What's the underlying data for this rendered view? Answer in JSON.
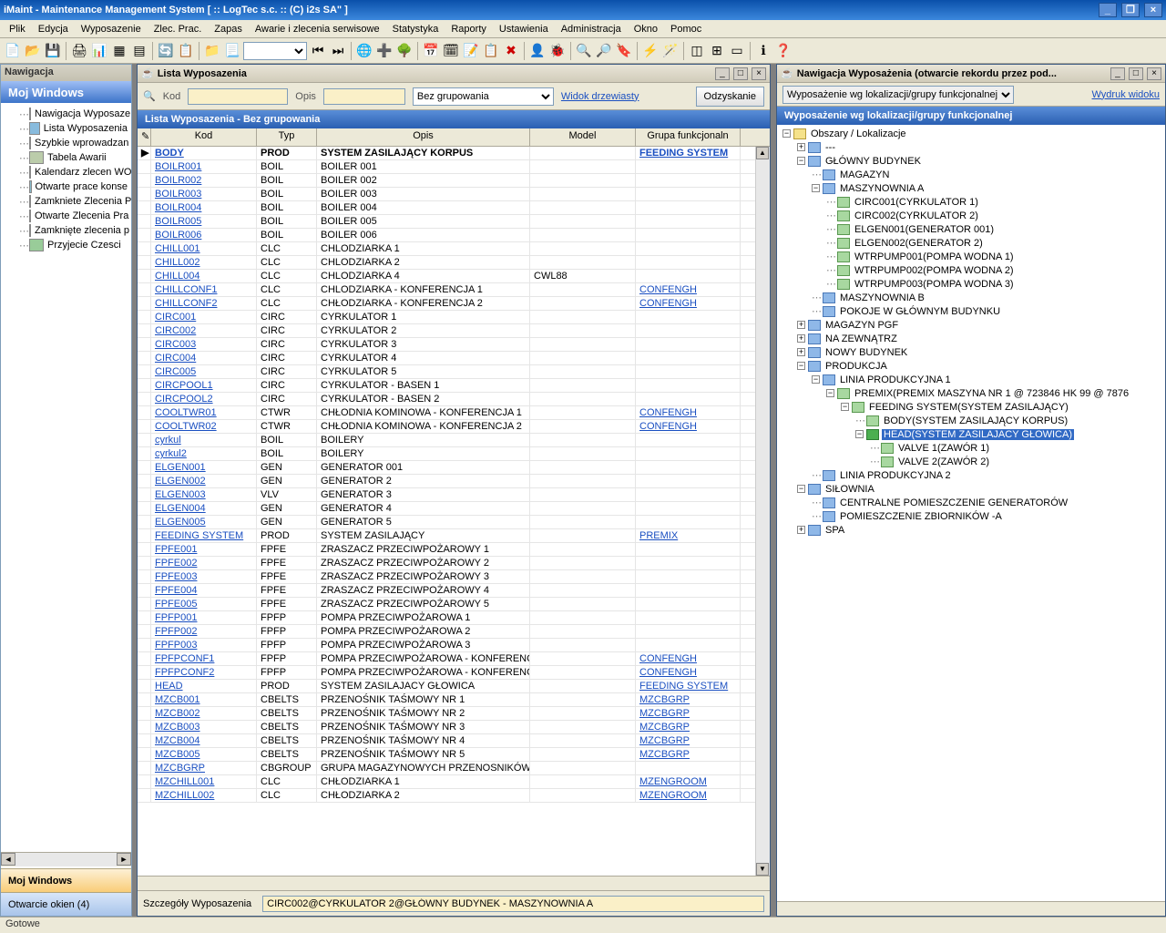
{
  "app": {
    "title": "iMaint - Maintenance Management System [ :: LogTec s.c. :: (C) i2s SA\" ]",
    "status": "Gotowe"
  },
  "menu": [
    "Plik",
    "Edycja",
    "Wyposazenie",
    "Zlec. Prac.",
    "Zapas",
    "Awarie i zlecenia serwisowe",
    "Statystyka",
    "Raporty",
    "Ustawienia",
    "Administracja",
    "Okno",
    "Pomoc"
  ],
  "nav": {
    "panel_title": "Nawigacja",
    "group": "Moj Windows",
    "items": [
      "Nawigacja Wyposaze",
      "Lista Wyposazenia",
      "Szybkie wprowadzan",
      "Tabela Awarii",
      "Kalendarz zlecen WO",
      "Otwarte prace konse",
      "Zamkniete Zlecenia P",
      "Otwarte Zlecenia Pra",
      "Zamknięte zlecenia p",
      "Przyjecie Czesci"
    ],
    "btn1": "Moj Windows",
    "btn2": "Otwarcie okien (4)"
  },
  "list": {
    "win_title": "Lista Wyposazenia",
    "kod_label": "Kod",
    "opis_label": "Opis",
    "group_select": "Bez grupowania",
    "tree_link": "Widok drzewiasty",
    "refresh_btn": "Odzyskanie",
    "grid_title": "Lista Wyposazenia - Bez grupowania",
    "cols": {
      "kod": "Kod",
      "typ": "Typ",
      "opis": "Opis",
      "model": "Model",
      "grupa": "Grupa funkcjonaln"
    },
    "detail_label": "Szczegóły Wyposazenia",
    "detail_value": "CIRC002@CYRKULATOR 2@GŁÓWNY BUDYNEK - MASZYNOWNIA A",
    "rows": [
      {
        "kod": "BODY",
        "typ": "PROD",
        "opis": "SYSTEM ZASILAJĄCY KORPUS",
        "model": "",
        "grupa": "FEEDING SYSTEM",
        "sel": true
      },
      {
        "kod": "BOILR001",
        "typ": "BOIL",
        "opis": "BOILER 001",
        "model": "",
        "grupa": ""
      },
      {
        "kod": "BOILR002",
        "typ": "BOIL",
        "opis": "BOILER 002",
        "model": "",
        "grupa": ""
      },
      {
        "kod": "BOILR003",
        "typ": "BOIL",
        "opis": "BOILER 003",
        "model": "",
        "grupa": ""
      },
      {
        "kod": "BOILR004",
        "typ": "BOIL",
        "opis": "BOILER 004",
        "model": "",
        "grupa": ""
      },
      {
        "kod": "BOILR005",
        "typ": "BOIL",
        "opis": "BOILER 005",
        "model": "",
        "grupa": ""
      },
      {
        "kod": "BOILR006",
        "typ": "BOIL",
        "opis": "BOILER 006",
        "model": "",
        "grupa": ""
      },
      {
        "kod": "CHILL001",
        "typ": "CLC",
        "opis": "CHLODZIARKA 1",
        "model": "",
        "grupa": ""
      },
      {
        "kod": "CHILL002",
        "typ": "CLC",
        "opis": "CHLODZIARKA 2",
        "model": "",
        "grupa": ""
      },
      {
        "kod": "CHILL004",
        "typ": "CLC",
        "opis": "CHLODZIARKA 4",
        "model": "CWL88",
        "grupa": ""
      },
      {
        "kod": "CHILLCONF1",
        "typ": "CLC",
        "opis": "CHLODZIARKA - KONFERENCJA 1",
        "model": "",
        "grupa": "CONFENGH"
      },
      {
        "kod": "CHILLCONF2",
        "typ": "CLC",
        "opis": "CHŁODZIARKA - KONFERENCJA 2",
        "model": "",
        "grupa": "CONFENGH"
      },
      {
        "kod": "CIRC001",
        "typ": "CIRC",
        "opis": "CYRKULATOR 1",
        "model": "",
        "grupa": ""
      },
      {
        "kod": "CIRC002",
        "typ": "CIRC",
        "opis": "CYRKULATOR 2",
        "model": "",
        "grupa": ""
      },
      {
        "kod": "CIRC003",
        "typ": "CIRC",
        "opis": "CYRKULATOR 3",
        "model": "",
        "grupa": ""
      },
      {
        "kod": "CIRC004",
        "typ": "CIRC",
        "opis": "CYRKULATOR 4",
        "model": "",
        "grupa": ""
      },
      {
        "kod": "CIRC005",
        "typ": "CIRC",
        "opis": "CYRKULATOR 5",
        "model": "",
        "grupa": ""
      },
      {
        "kod": "CIRCPOOL1",
        "typ": "CIRC",
        "opis": "CYRKULATOR - BASEN 1",
        "model": "",
        "grupa": ""
      },
      {
        "kod": "CIRCPOOL2",
        "typ": "CIRC",
        "opis": "CYRKULATOR - BASEN 2",
        "model": "",
        "grupa": ""
      },
      {
        "kod": "COOLTWR01",
        "typ": "CTWR",
        "opis": "CHŁODNIA KOMINOWA - KONFERENCJA 1",
        "model": "",
        "grupa": "CONFENGH"
      },
      {
        "kod": "COOLTWR02",
        "typ": "CTWR",
        "opis": "CHŁODNIA KOMINOWA - KONFERENCJA 2",
        "model": "",
        "grupa": "CONFENGH"
      },
      {
        "kod": "cyrkul",
        "typ": "BOIL",
        "opis": "BOILERY",
        "model": "",
        "grupa": ""
      },
      {
        "kod": "cyrkul2",
        "typ": "BOIL",
        "opis": "BOILERY",
        "model": "",
        "grupa": ""
      },
      {
        "kod": "ELGEN001",
        "typ": "GEN",
        "opis": "GENERATOR 001",
        "model": "",
        "grupa": ""
      },
      {
        "kod": "ELGEN002",
        "typ": "GEN",
        "opis": "GENERATOR 2",
        "model": "",
        "grupa": ""
      },
      {
        "kod": "ELGEN003",
        "typ": "VLV",
        "opis": "GENERATOR 3",
        "model": "",
        "grupa": ""
      },
      {
        "kod": "ELGEN004",
        "typ": "GEN",
        "opis": "GENERATOR 4",
        "model": "",
        "grupa": ""
      },
      {
        "kod": "ELGEN005",
        "typ": "GEN",
        "opis": "GENERATOR 5",
        "model": "",
        "grupa": ""
      },
      {
        "kod": "FEEDING SYSTEM",
        "typ": "PROD",
        "opis": "SYSTEM ZASILAJĄCY",
        "model": "",
        "grupa": "PREMIX"
      },
      {
        "kod": "FPFE001",
        "typ": "FPFE",
        "opis": "ZRASZACZ PRZECIWPOŻAROWY 1",
        "model": "",
        "grupa": ""
      },
      {
        "kod": "FPFE002",
        "typ": "FPFE",
        "opis": "ZRASZACZ PRZECIWPOŻAROWY 2",
        "model": "",
        "grupa": ""
      },
      {
        "kod": "FPFE003",
        "typ": "FPFE",
        "opis": "ZRASZACZ PRZECIWPOŻAROWY 3",
        "model": "",
        "grupa": ""
      },
      {
        "kod": "FPFE004",
        "typ": "FPFE",
        "opis": "ZRASZACZ PRZECIWPOŻAROWY 4",
        "model": "",
        "grupa": ""
      },
      {
        "kod": "FPFE005",
        "typ": "FPFE",
        "opis": "ZRASZACZ PRZECIWPOŻAROWY 5",
        "model": "",
        "grupa": ""
      },
      {
        "kod": "FPFP001",
        "typ": "FPFP",
        "opis": "POMPA PRZECIWPOŻAROWA 1",
        "model": "",
        "grupa": ""
      },
      {
        "kod": "FPFP002",
        "typ": "FPFP",
        "opis": "POMPA PRZECIWPOŻAROWA 2",
        "model": "",
        "grupa": ""
      },
      {
        "kod": "FPFP003",
        "typ": "FPFP",
        "opis": "POMPA PRZECIWPOŻAROWA 3",
        "model": "",
        "grupa": ""
      },
      {
        "kod": "FPFPCONF1",
        "typ": "FPFP",
        "opis": "POMPA PRZECIWPOŻAROWA - KONFERENC:",
        "model": "",
        "grupa": "CONFENGH"
      },
      {
        "kod": "FPFPCONF2",
        "typ": "FPFP",
        "opis": "POMPA PRZECIWPOŻAROWA - KONFERENC:",
        "model": "",
        "grupa": "CONFENGH"
      },
      {
        "kod": "HEAD",
        "typ": "PROD",
        "opis": "SYSTEM ZASILAJACY GŁOWICA",
        "model": "",
        "grupa": "FEEDING SYSTEM"
      },
      {
        "kod": "MZCB001",
        "typ": "CBELTS",
        "opis": "PRZENOŚNIK TAŚMOWY NR 1",
        "model": "",
        "grupa": "MZCBGRP"
      },
      {
        "kod": "MZCB002",
        "typ": "CBELTS",
        "opis": "PRZENOŚNIK TAŚMOWY NR 2",
        "model": "",
        "grupa": "MZCBGRP"
      },
      {
        "kod": "MZCB003",
        "typ": "CBELTS",
        "opis": "PRZENOŚNIK TAŚMOWY NR 3",
        "model": "",
        "grupa": "MZCBGRP"
      },
      {
        "kod": "MZCB004",
        "typ": "CBELTS",
        "opis": "PRZENOŚNIK TAŚMOWY NR 4",
        "model": "",
        "grupa": "MZCBGRP"
      },
      {
        "kod": "MZCB005",
        "typ": "CBELTS",
        "opis": "PRZENOŚNIK TAŚMOWY NR 5",
        "model": "",
        "grupa": "MZCBGRP"
      },
      {
        "kod": "MZCBGRP",
        "typ": "CBGROUP",
        "opis": "GRUPA MAGAZYNOWYCH PRZENOSNIKÓW T",
        "model": "",
        "grupa": ""
      },
      {
        "kod": "MZCHILL001",
        "typ": "CLC",
        "opis": "CHŁODZIARKA 1",
        "model": "",
        "grupa": "MZENGROOM"
      },
      {
        "kod": "MZCHILL002",
        "typ": "CLC",
        "opis": "CHŁODZIARKA 2",
        "model": "",
        "grupa": "MZENGROOM"
      }
    ]
  },
  "tree": {
    "win_title": "Nawigacja Wyposażenia (otwarcie rekordu przez pod...",
    "filter_select": "Wyposażenie wg lokalizacji/grupy funkcjonalnej",
    "print_link": "Wydruk widoku",
    "title": "Wyposażenie wg lokalizacji/grupy funkcjonalnej",
    "nodes": [
      {
        "d": 0,
        "t": "-",
        "ico": "f",
        "lbl": "Obszary / Lokalizacje"
      },
      {
        "d": 1,
        "t": "+",
        "ico": "",
        "lbl": "---"
      },
      {
        "d": 1,
        "t": "-",
        "ico": "",
        "lbl": "GŁÓWNY BUDYNEK"
      },
      {
        "d": 2,
        "t": "",
        "ico": "",
        "lbl": "MAGAZYN"
      },
      {
        "d": 2,
        "t": "-",
        "ico": "",
        "lbl": "MASZYNOWNIA A"
      },
      {
        "d": 3,
        "t": "",
        "ico": "g",
        "lbl": "CIRC001(CYRKULATOR 1)"
      },
      {
        "d": 3,
        "t": "",
        "ico": "g",
        "lbl": "CIRC002(CYRKULATOR 2)"
      },
      {
        "d": 3,
        "t": "",
        "ico": "g",
        "lbl": "ELGEN001(GENERATOR 001)"
      },
      {
        "d": 3,
        "t": "",
        "ico": "g",
        "lbl": "ELGEN002(GENERATOR 2)"
      },
      {
        "d": 3,
        "t": "",
        "ico": "g",
        "lbl": "WTRPUMP001(POMPA WODNA 1)"
      },
      {
        "d": 3,
        "t": "",
        "ico": "g",
        "lbl": "WTRPUMP002(POMPA WODNA 2)"
      },
      {
        "d": 3,
        "t": "",
        "ico": "g",
        "lbl": "WTRPUMP003(POMPA WODNA 3)"
      },
      {
        "d": 2,
        "t": "",
        "ico": "",
        "lbl": "MASZYNOWNIA B"
      },
      {
        "d": 2,
        "t": "",
        "ico": "",
        "lbl": "POKOJE W GŁÓWNYM BUDYNKU"
      },
      {
        "d": 1,
        "t": "+",
        "ico": "",
        "lbl": "MAGAZYN PGF"
      },
      {
        "d": 1,
        "t": "+",
        "ico": "",
        "lbl": "NA ZEWNĄTRZ"
      },
      {
        "d": 1,
        "t": "+",
        "ico": "",
        "lbl": "NOWY BUDYNEK"
      },
      {
        "d": 1,
        "t": "-",
        "ico": "",
        "lbl": "PRODUKCJA"
      },
      {
        "d": 2,
        "t": "-",
        "ico": "",
        "lbl": "LINIA PRODUKCYJNA 1"
      },
      {
        "d": 3,
        "t": "-",
        "ico": "g",
        "lbl": "PREMIX(PREMIX MASZYNA NR 1 @ 723846 HK 99 @ 7876"
      },
      {
        "d": 4,
        "t": "-",
        "ico": "g",
        "lbl": "FEEDING SYSTEM(SYSTEM ZASILAJĄCY)"
      },
      {
        "d": 5,
        "t": "",
        "ico": "g",
        "lbl": "BODY(SYSTEM ZASILAJĄCY KORPUS)"
      },
      {
        "d": 5,
        "t": "-",
        "ico": "arrow",
        "lbl": "HEAD(SYSTEM ZASILAJACY GŁOWICA)",
        "hl": true
      },
      {
        "d": 6,
        "t": "",
        "ico": "g",
        "lbl": "VALVE 1(ZAWÓR 1)"
      },
      {
        "d": 6,
        "t": "",
        "ico": "g",
        "lbl": "VALVE 2(ZAWÓR 2)"
      },
      {
        "d": 2,
        "t": "",
        "ico": "",
        "lbl": "LINIA PRODUKCYJNA 2"
      },
      {
        "d": 1,
        "t": "-",
        "ico": "",
        "lbl": "SIŁOWNIA"
      },
      {
        "d": 2,
        "t": "",
        "ico": "",
        "lbl": "CENTRALNE POMIESZCZENIE GENERATORÓW"
      },
      {
        "d": 2,
        "t": "",
        "ico": "",
        "lbl": "POMIESZCZENIE ZBIORNIKÓW -A"
      },
      {
        "d": 1,
        "t": "+",
        "ico": "",
        "lbl": "SPA"
      }
    ]
  }
}
